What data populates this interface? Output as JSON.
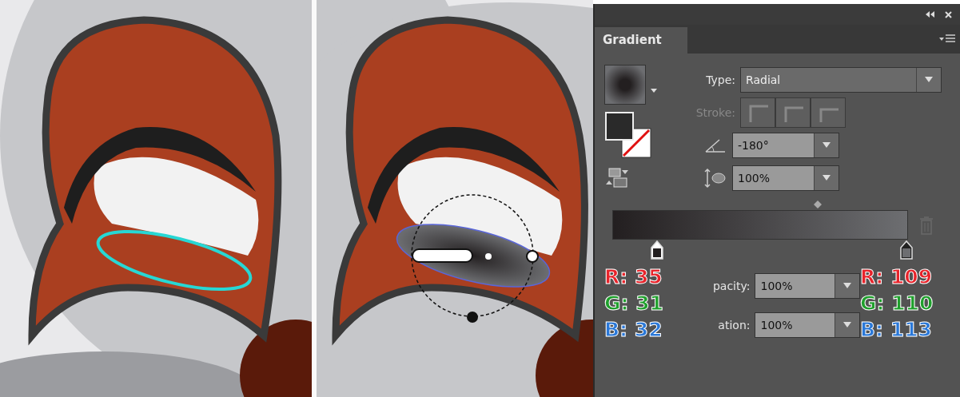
{
  "panel": {
    "tab": "Gradient",
    "type_label": "Type:",
    "type_value": "Radial",
    "stroke_label": "Stroke:",
    "stroke_disabled": true,
    "angle": "-180°",
    "aspect": "100%",
    "stops": [
      {
        "color": "#231f20",
        "selected": false
      },
      {
        "color": "#6d6e71",
        "selected": true
      }
    ],
    "opacity_label": "pacity:",
    "opacity": "100%",
    "location_label": "ation:",
    "location": "100%"
  },
  "annotations": [
    {
      "r": "R: 35",
      "g": "G: 31",
      "b": "B: 32"
    },
    {
      "r": "R: 109",
      "g": "G: 110",
      "b": "B: 113"
    }
  ]
}
